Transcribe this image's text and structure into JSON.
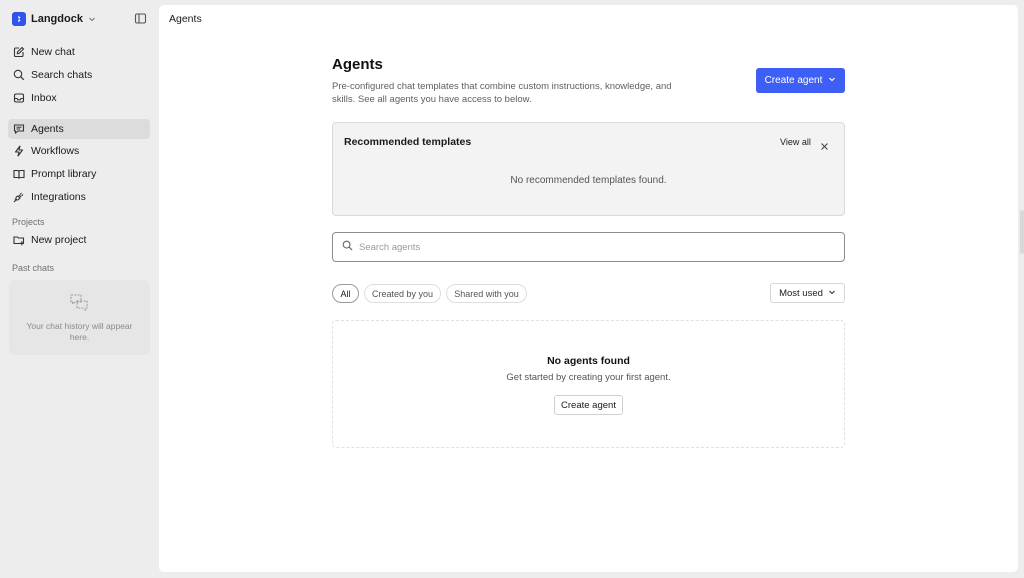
{
  "sidebar": {
    "brand": "Langdock",
    "nav": [
      {
        "label": "New chat",
        "icon": "edit-icon"
      },
      {
        "label": "Search chats",
        "icon": "search-icon"
      },
      {
        "label": "Inbox",
        "icon": "inbox-icon"
      }
    ],
    "main_nav": [
      {
        "label": "Agents",
        "icon": "agents-icon",
        "active": true
      },
      {
        "label": "Workflows",
        "icon": "lightning-icon"
      },
      {
        "label": "Prompt library",
        "icon": "book-icon"
      },
      {
        "label": "Integrations",
        "icon": "plug-icon"
      }
    ],
    "projects_label": "Projects",
    "new_project": "New project",
    "past_chats_label": "Past chats",
    "empty_history": "Your chat history will appear here."
  },
  "topbar": {
    "title": "Agents"
  },
  "page": {
    "title": "Agents",
    "description": "Pre-configured chat templates that combine custom instructions, knowledge, and skills. See all agents you have access to below.",
    "create_button": "Create agent"
  },
  "recommended": {
    "title": "Recommended templates",
    "view_all": "View all",
    "empty": "No recommended templates found."
  },
  "search": {
    "placeholder": "Search agents",
    "value": ""
  },
  "filters": {
    "chips": [
      "All",
      "Created by you",
      "Shared with you"
    ],
    "active": "All",
    "sort": "Most used"
  },
  "empty_state": {
    "title": "No agents found",
    "subtitle": "Get started by creating your first agent.",
    "button": "Create agent"
  },
  "colors": {
    "accent": "#3d5ff5",
    "brand": "#2f54eb",
    "active_nav": "#dcdcdc"
  }
}
